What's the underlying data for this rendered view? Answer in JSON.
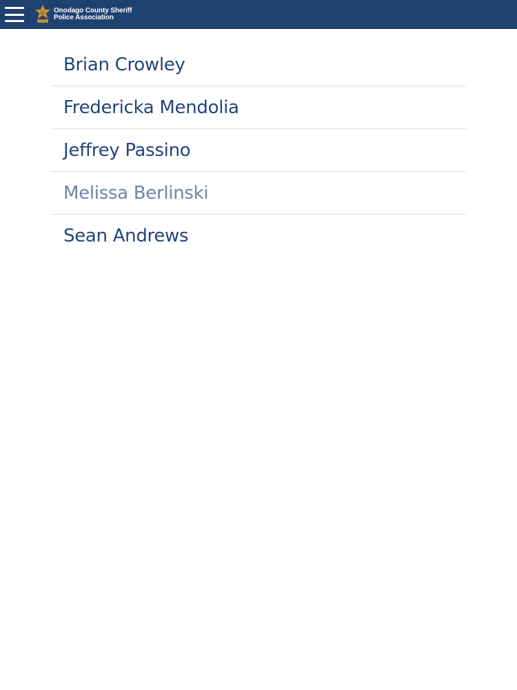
{
  "header": {
    "menu_icon": "hamburger-menu-icon",
    "logo_icon": "sheriff-star-badge-icon",
    "title_line1": "Onodago County Sheriff",
    "title_line2": "Police Association",
    "bar_color": "#1f4170"
  },
  "members": {
    "items": [
      {
        "label": "Brian Crowley",
        "active": true
      },
      {
        "label": "Fredericka Mendolia",
        "active": true
      },
      {
        "label": "Jeffrey Passino",
        "active": true
      },
      {
        "label": "Melissa Berlinski",
        "active": false
      },
      {
        "label": "Sean Andrews",
        "active": true
      }
    ],
    "text_color": "#23457a",
    "dim_text_color": "#6f85a6"
  }
}
